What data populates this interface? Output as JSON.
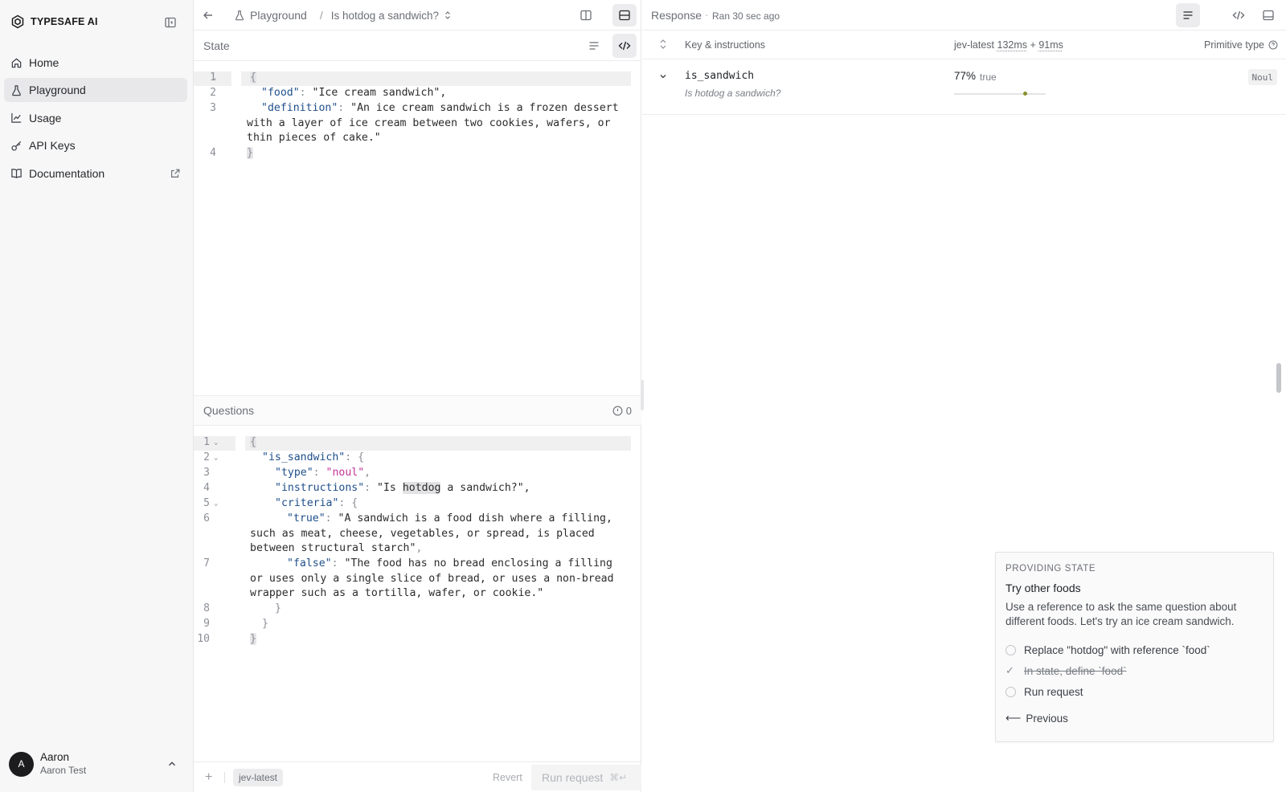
{
  "app": {
    "brand": "TYPESAFE AI"
  },
  "sidebar": {
    "items": [
      {
        "label": "Home",
        "icon": "home-icon"
      },
      {
        "label": "Playground",
        "icon": "flask-icon"
      },
      {
        "label": "Usage",
        "icon": "line-chart-icon"
      },
      {
        "label": "API Keys",
        "icon": "key-icon"
      },
      {
        "label": "Documentation",
        "icon": "book-icon"
      }
    ],
    "active": "Playground",
    "user": {
      "initial": "A",
      "name": "Aaron",
      "subtitle": "Aaron Test"
    }
  },
  "breadcrumb": {
    "root": "Playground",
    "separator": "/",
    "current": "Is hotdog a sandwich?"
  },
  "state_panel": {
    "title": "State",
    "lines": [
      {
        "n": "1",
        "fold": true
      },
      {
        "n": "2",
        "key": "\"food\"",
        "value": "\"Ice cream sandwich\","
      },
      {
        "n": "3",
        "key": "\"definition\"",
        "value": "\"An ice cream sandwich is a frozen dessert with a layer of ice cream between two cookies, wafers, or thin pieces of cake.\""
      },
      {
        "n": "4"
      }
    ]
  },
  "questions_panel": {
    "title": "Questions",
    "issue_count": "0",
    "lines": [
      {
        "n": "1",
        "fold": true
      },
      {
        "n": "2",
        "fold": true,
        "key": "\"is_sandwich\""
      },
      {
        "n": "3",
        "key": "\"type\"",
        "value": "\"noul\""
      },
      {
        "n": "4",
        "key": "\"instructions\"",
        "value_pre": "\"Is ",
        "value_mark": "hotdog",
        "value_post": " a sandwich?\","
      },
      {
        "n": "5",
        "fold": true,
        "key": "\"criteria\""
      },
      {
        "n": "6",
        "key": "\"true\"",
        "value": "\"A sandwich is a food dish where a filling, such as meat, cheese, vegetables, or spread, is placed between structural starch\""
      },
      {
        "n": "7",
        "key": "\"false\"",
        "value": "\"The food has no bread enclosing a filling or uses only a single slice of bread, or uses a non-bread wrapper such as a tortilla, wafer, or cookie.\""
      },
      {
        "n": "8"
      },
      {
        "n": "9"
      },
      {
        "n": "10"
      }
    ]
  },
  "footer": {
    "model": "jev-latest",
    "revert": "Revert",
    "run": "Run request",
    "shortcut": "⌘↵"
  },
  "response": {
    "title": "Response",
    "ran": "Ran 30 sec ago",
    "columns": {
      "key": "Key & instructions",
      "model": "jev-latest",
      "latency1": "132ms",
      "plus": "+",
      "latency2": "91ms",
      "type": "Primitive type"
    },
    "rows": [
      {
        "key": "is_sandwich",
        "instructions": "Is hotdog a sandwich?",
        "confidence": "77%",
        "value": "true",
        "confidence_fraction": 0.77,
        "type": "Noul"
      }
    ]
  },
  "tutorial": {
    "eyebrow": "PROVIDING STATE",
    "title": "Try other foods",
    "body": "Use a reference to ask the same question about different foods. Let's try an ice cream sandwich.",
    "steps": [
      {
        "label": "Replace \"hotdog\" with reference `food`",
        "done": false
      },
      {
        "label": "In state, define `food`",
        "done": true
      },
      {
        "label": "Run request",
        "done": false
      }
    ],
    "previous": "Previous",
    "previous_arrow": "⟵"
  },
  "colors": {
    "accent_dot": "#8a8f2a",
    "active_nav": "#e8e8ea",
    "sidebar_bg": "#f7f7f8"
  }
}
